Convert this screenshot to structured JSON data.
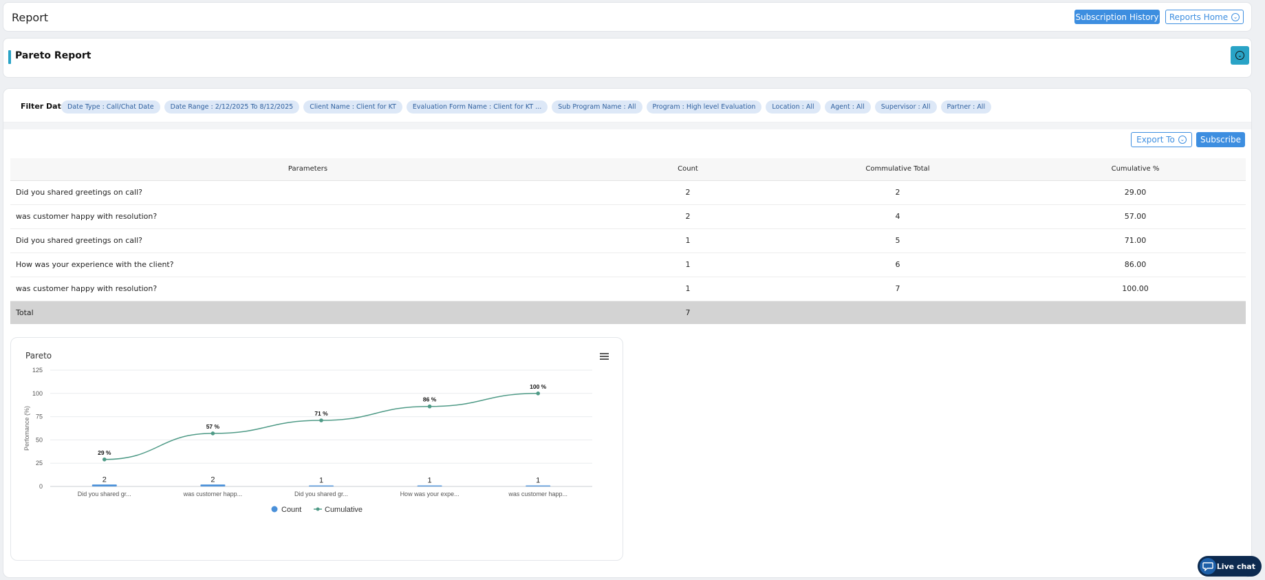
{
  "header": {
    "title": "Report",
    "subscription_history_label": "Subscription History",
    "reports_home_label": "Reports Home"
  },
  "section": {
    "title": "Pareto Report"
  },
  "filters": {
    "label": "Filter Data",
    "chips": [
      "Date Type : Call/Chat Date",
      "Date Range : 2/12/2025 To 8/12/2025",
      "Client Name : Client for KT",
      "Evaluation Form Name : Client for KT ...",
      "Sub Program Name : All",
      "Program : High level Evaluation",
      "Location : All",
      "Agent : All",
      "Supervisor : All",
      "Partner : All"
    ]
  },
  "actions": {
    "export_label": "Export To",
    "subscribe_label": "Subscribe"
  },
  "table": {
    "headers": [
      "Parameters",
      "Count",
      "Commulative Total",
      "Cumulative %"
    ],
    "rows": [
      [
        "Did you shared greetings on call?",
        "2",
        "2",
        "29.00"
      ],
      [
        "was customer happy with resolution?",
        "2",
        "4",
        "57.00"
      ],
      [
        "Did you shared greetings on call?",
        "1",
        "5",
        "71.00"
      ],
      [
        "How was your experience with the client?",
        "1",
        "6",
        "86.00"
      ],
      [
        "was customer happy with resolution?",
        "1",
        "7",
        "100.00"
      ]
    ],
    "total": {
      "label": "Total",
      "count": "7"
    }
  },
  "chart": {
    "title": "Pareto"
  },
  "chart_data": {
    "type": "bar",
    "title": "Pareto",
    "ylabel": "Perfomance (%)",
    "xlabel": "",
    "ylim": [
      0,
      125
    ],
    "yticks": [
      0,
      25,
      50,
      75,
      100,
      125
    ],
    "grid": true,
    "legend_position": "bottom",
    "categories": [
      "Did you shared gr...",
      "was customer happ...",
      "Did you shared gr...",
      "How was your expe...",
      "was customer happ..."
    ],
    "series": [
      {
        "name": "Count",
        "type": "bar",
        "color": "#4a90d9",
        "values": [
          2,
          2,
          1,
          1,
          1
        ]
      },
      {
        "name": "Cumulative",
        "type": "line",
        "color": "#4e9a86",
        "values": [
          29,
          57,
          71,
          86,
          100
        ]
      }
    ],
    "line_labels": [
      "29 %",
      "57 %",
      "71 %",
      "86 %",
      "100 %"
    ]
  },
  "livechat": {
    "label": "Live chat"
  }
}
